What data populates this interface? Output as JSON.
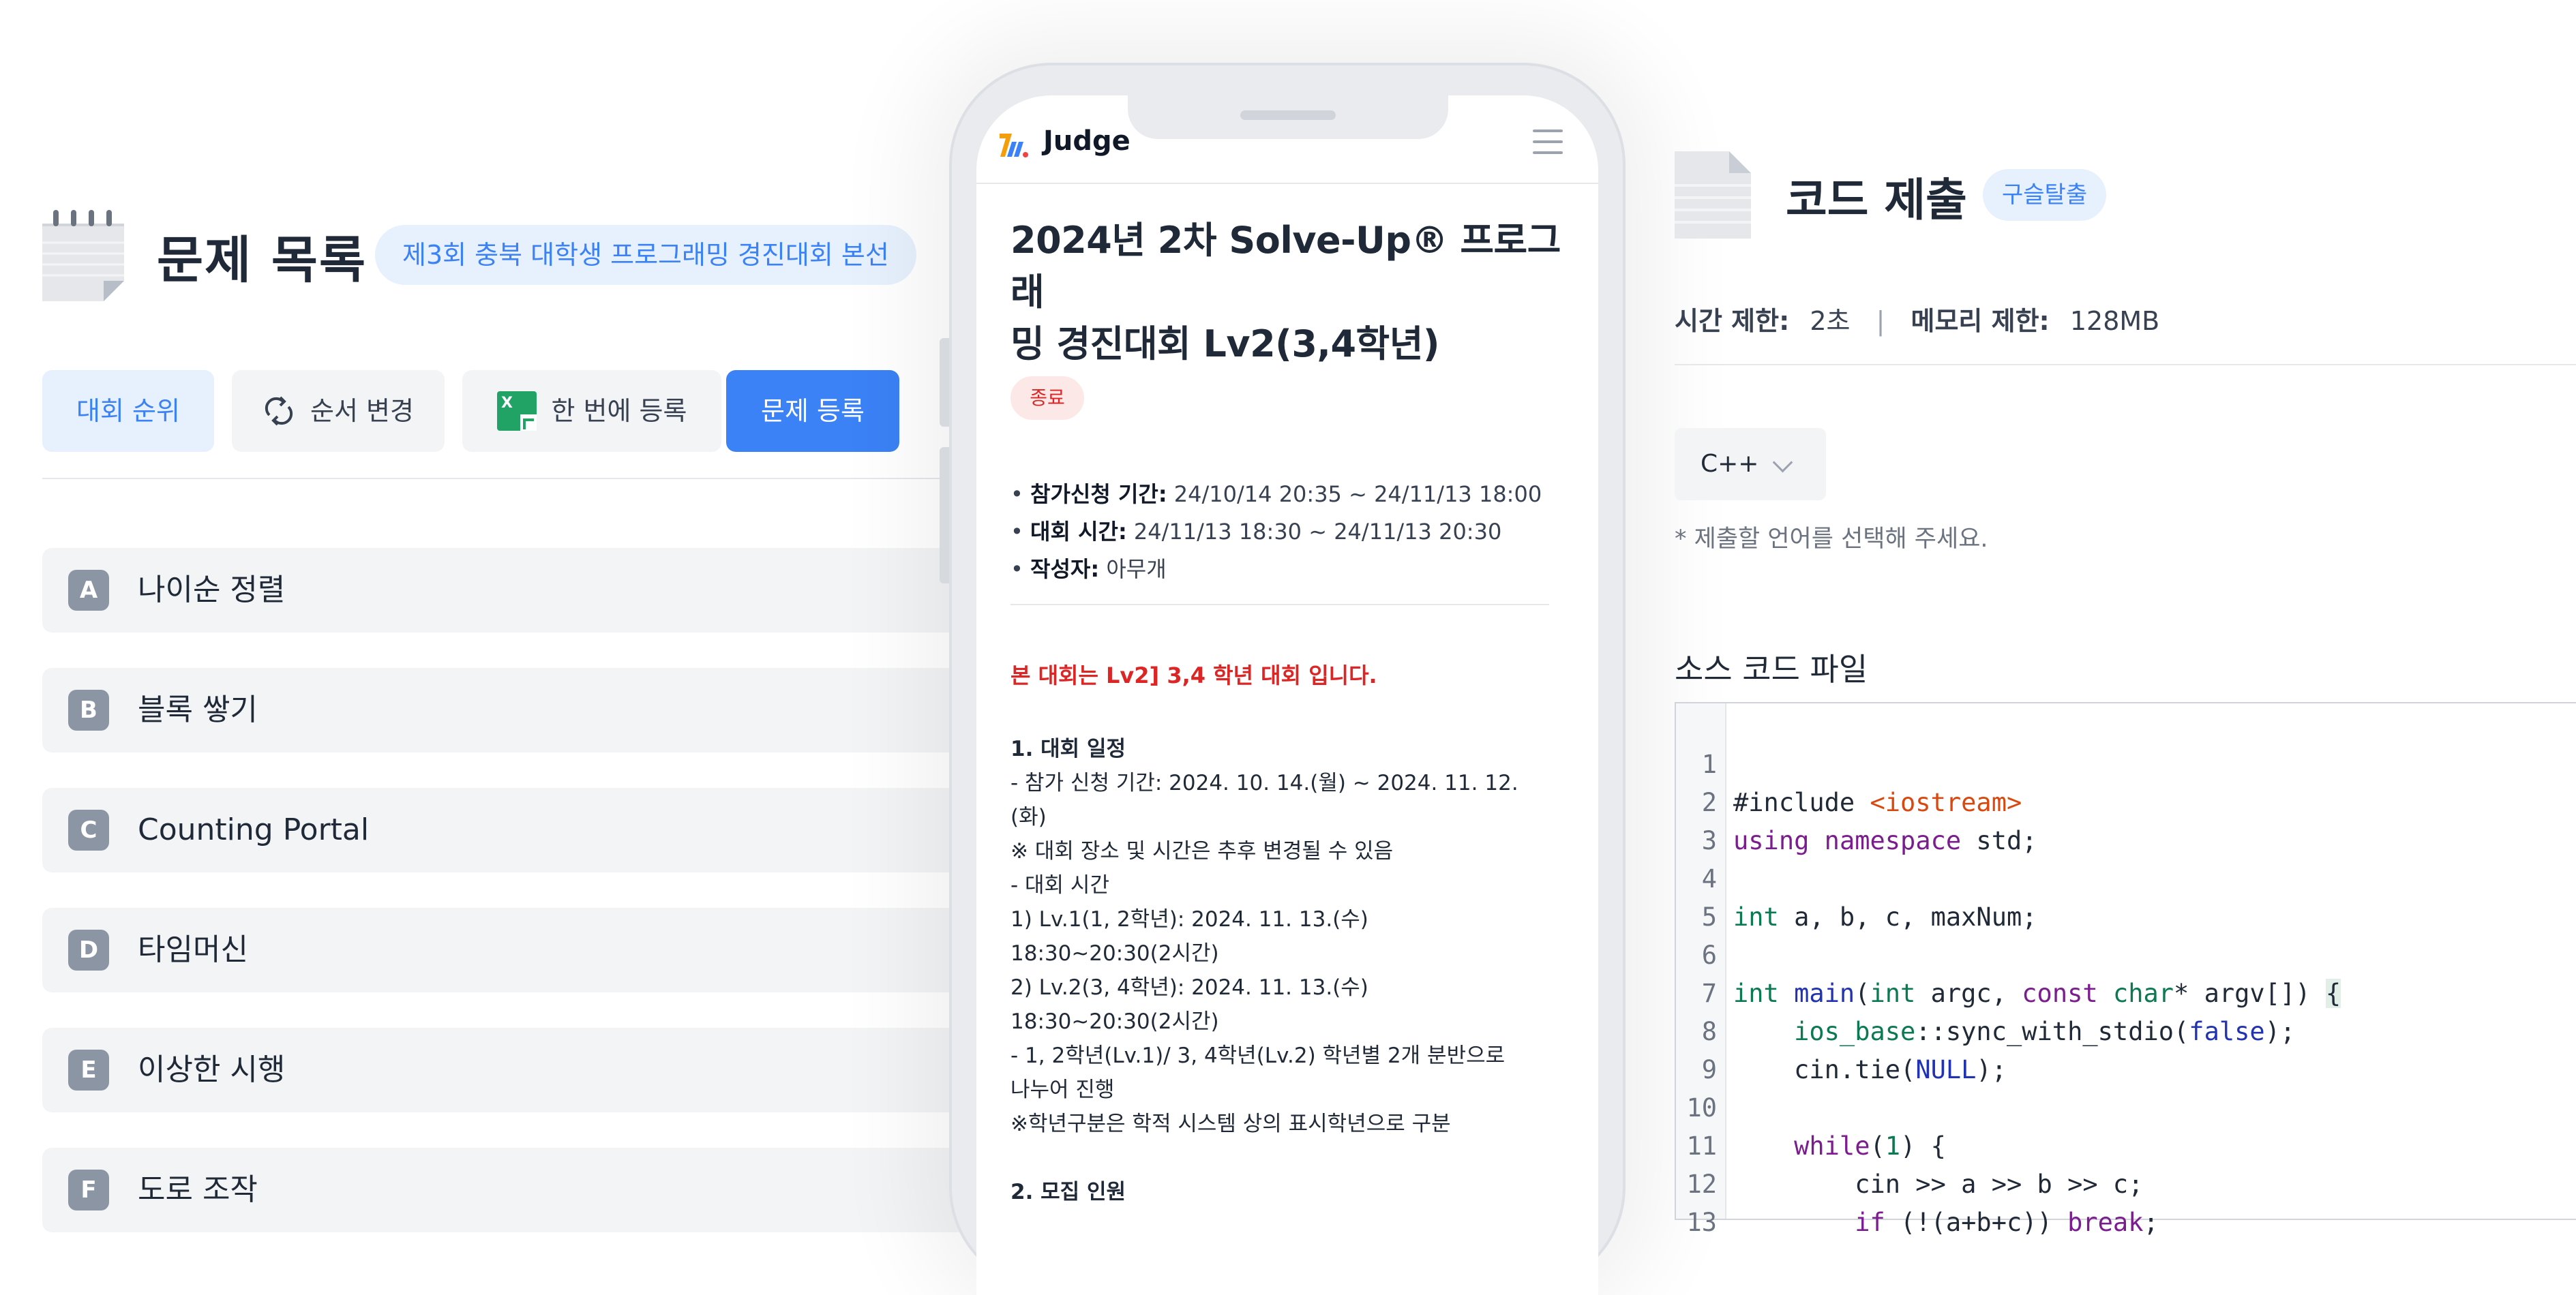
{
  "left_panel": {
    "title": "문제 목록",
    "contest_badge": "제3회 충북 대학생 프로그래밍 경진대회 본선",
    "buttons": {
      "ranking": "대회 순위",
      "change_order": "순서 변경",
      "bulk_register": "한 번에 등록",
      "register_problem": "문제 등록"
    },
    "problems": [
      {
        "letter": "A",
        "name": "나이순 정렬"
      },
      {
        "letter": "B",
        "name": "블록 쌓기"
      },
      {
        "letter": "C",
        "name": "Counting Portal"
      },
      {
        "letter": "D",
        "name": "타임머신"
      },
      {
        "letter": "E",
        "name": "이상한 시행"
      },
      {
        "letter": "F",
        "name": "도로 조작"
      }
    ]
  },
  "phone": {
    "brand": "Judge",
    "contest_title_line1": "2024년 2차 Solve-Up® 프로그래",
    "contest_title_line2": "밍 경진대회 Lv2(3,4학년)",
    "status": "종료",
    "meta": {
      "application_label": "참가신청 기간:",
      "application_value": "24/10/14 20:35 ~ 24/11/13 18:00",
      "contest_time_label": "대회 시간:",
      "contest_time_value": "24/11/13 18:30 ~ 24/11/13 20:30",
      "author_label": "작성자:",
      "author_value": "아무개"
    },
    "notice": "본 대회는 Lv2] 3,4 학년 대회 입니다.",
    "body_lines": [
      "1. 대회 일정",
      " - 참가 신청 기간: 2024. 10. 14.(월) ~ 2024. 11. 12.",
      "(화)",
      "            ※ 대회 장소 및 시간은 추후 변경될 수 있음",
      " - 대회 시간",
      " 1) Lv.1(1, 2학년): 2024. 11. 13.(수)",
      "18:30~20:30(2시간)",
      " 2) Lv.2(3, 4학년): 2024. 11. 13.(수)",
      "18:30~20:30(2시간)",
      " - 1, 2학년(Lv.1)/ 3, 4학년(Lv.2) 학년별 2개 분반으로",
      "나누어 진행",
      " ※학년구분은 학적 시스템 상의 표시학년으로 구분",
      "",
      "2. 모집 인원"
    ]
  },
  "right_panel": {
    "title": "코드 제출",
    "tag": "구슬탈출",
    "time_limit_label": "시간 제한:",
    "time_limit_value": "2초",
    "memory_limit_label": "메모리 제한:",
    "memory_limit_value": "128MB",
    "language": "C++",
    "language_hint": "* 제출할 언어를 선택해 주세요.",
    "source_label": "소스 코드 파일",
    "code_lines": [
      {
        "n": "1"
      },
      {
        "n": "2"
      },
      {
        "n": "3"
      },
      {
        "n": "4"
      },
      {
        "n": "5"
      },
      {
        "n": "6"
      },
      {
        "n": "7"
      },
      {
        "n": "8"
      },
      {
        "n": "9"
      },
      {
        "n": "10"
      },
      {
        "n": "11"
      },
      {
        "n": "12"
      },
      {
        "n": "13"
      }
    ],
    "code_tokens": {
      "l1_a": "#include ",
      "l1_b": "<iostream>",
      "l2_a": "using",
      "l2_b": " ",
      "l2_c": "namespace",
      "l2_d": " std;",
      "l4_a": "int",
      "l4_b": " a, b, c, maxNum;",
      "l6_a": "int",
      "l6_b": " ",
      "l6_c": "main",
      "l6_d": "(",
      "l6_e": "int",
      "l6_f": " argc, ",
      "l6_g": "const",
      "l6_h": " ",
      "l6_i": "char",
      "l6_j": "* argv[]) ",
      "l6_k": "{",
      "l7_a": "    ",
      "l7_b": "ios_base",
      "l7_c": "::sync_with_stdio(",
      "l7_d": "false",
      "l7_e": ");",
      "l8_a": "    cin.tie(",
      "l8_b": "NULL",
      "l8_c": ");",
      "l10_a": "    ",
      "l10_b": "while",
      "l10_c": "(",
      "l10_d": "1",
      "l10_e": ") {",
      "l11_a": "        cin >> a >> b >> c;",
      "l12_a": "        ",
      "l12_b": "if",
      "l12_c": " (!(a+b+c)) ",
      "l12_d": "break",
      "l12_e": ";"
    }
  }
}
